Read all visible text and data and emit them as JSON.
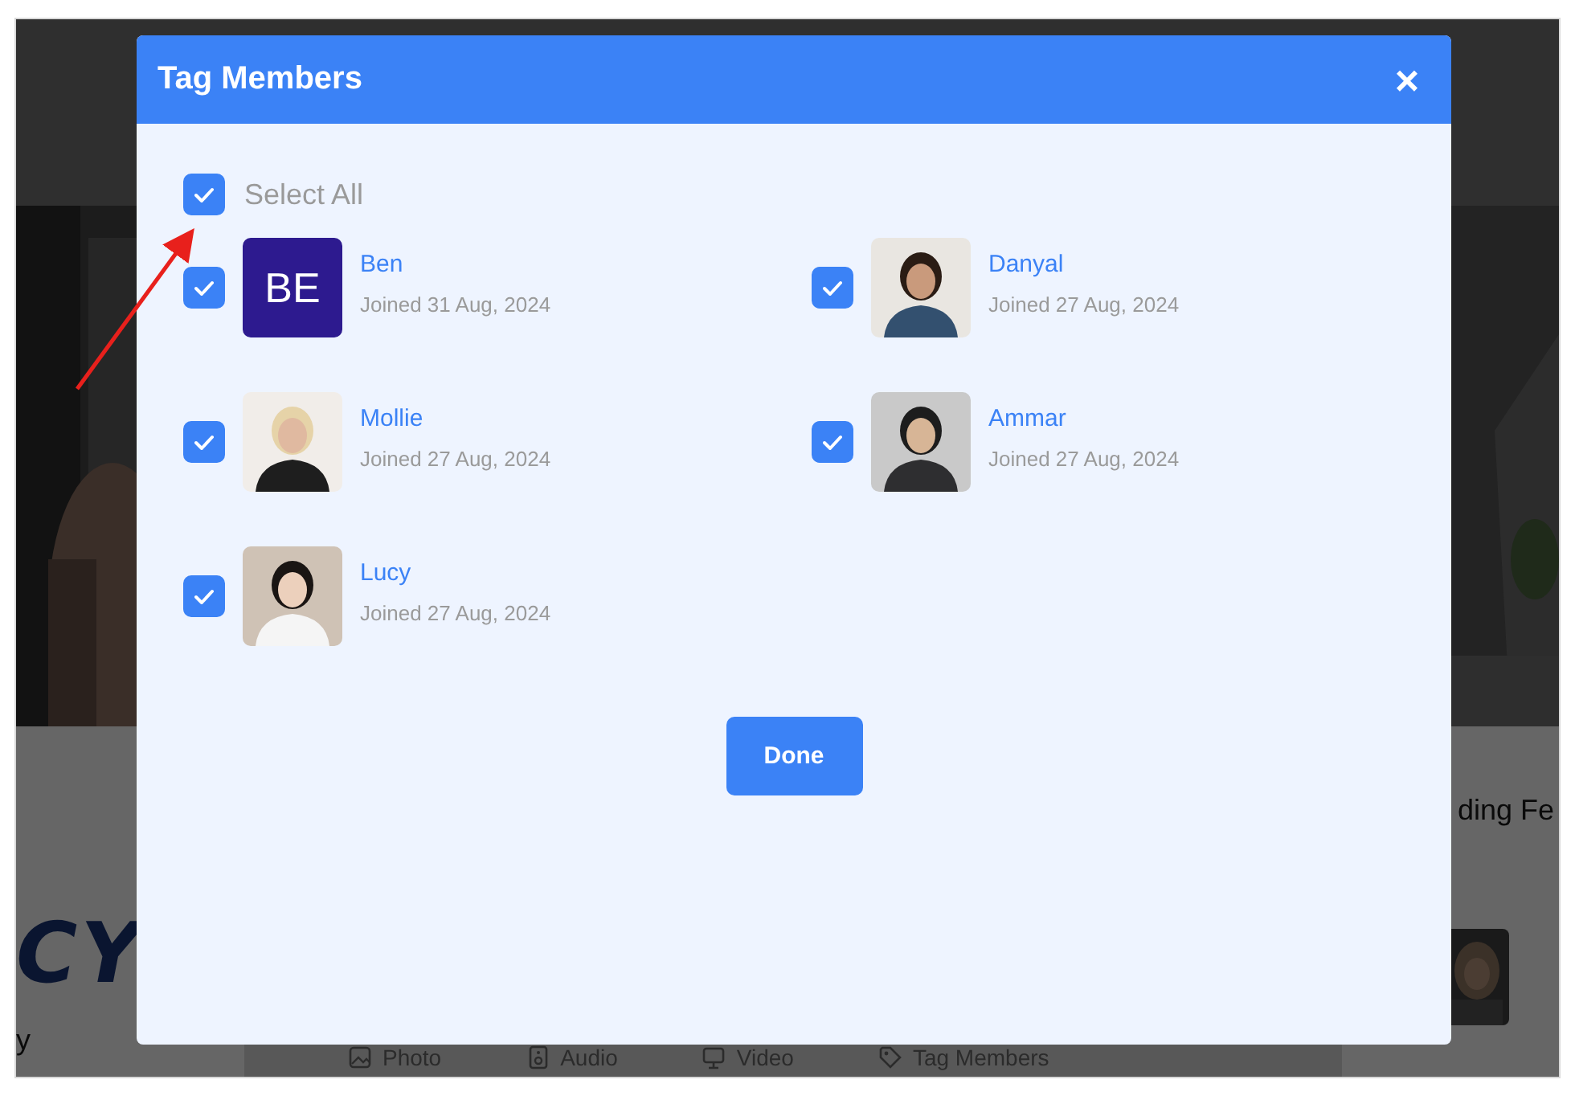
{
  "background": {
    "brand_fragment": "CY",
    "text_fragment": "y",
    "section_fragment": "ding Fe",
    "composer_actions": [
      {
        "label": "Photo"
      },
      {
        "label": "Audio"
      },
      {
        "label": "Video"
      },
      {
        "label": "Tag Members"
      }
    ]
  },
  "modal": {
    "title": "Tag Members",
    "close": "×",
    "select_all": {
      "label": "Select All",
      "checked": true
    },
    "members": [
      {
        "name": "Ben",
        "joined": "Joined 31 Aug, 2024",
        "checked": true,
        "avatar": {
          "kind": "initials",
          "text": "BE"
        }
      },
      {
        "name": "Danyal",
        "joined": "Joined 27 Aug, 2024",
        "checked": true
      },
      {
        "name": "Mollie",
        "joined": "Joined 27 Aug, 2024",
        "checked": true
      },
      {
        "name": "Ammar",
        "joined": "Joined 27 Aug, 2024",
        "checked": true
      },
      {
        "name": "Lucy",
        "joined": "Joined 27 Aug, 2024",
        "checked": true
      }
    ],
    "done": "Done"
  }
}
